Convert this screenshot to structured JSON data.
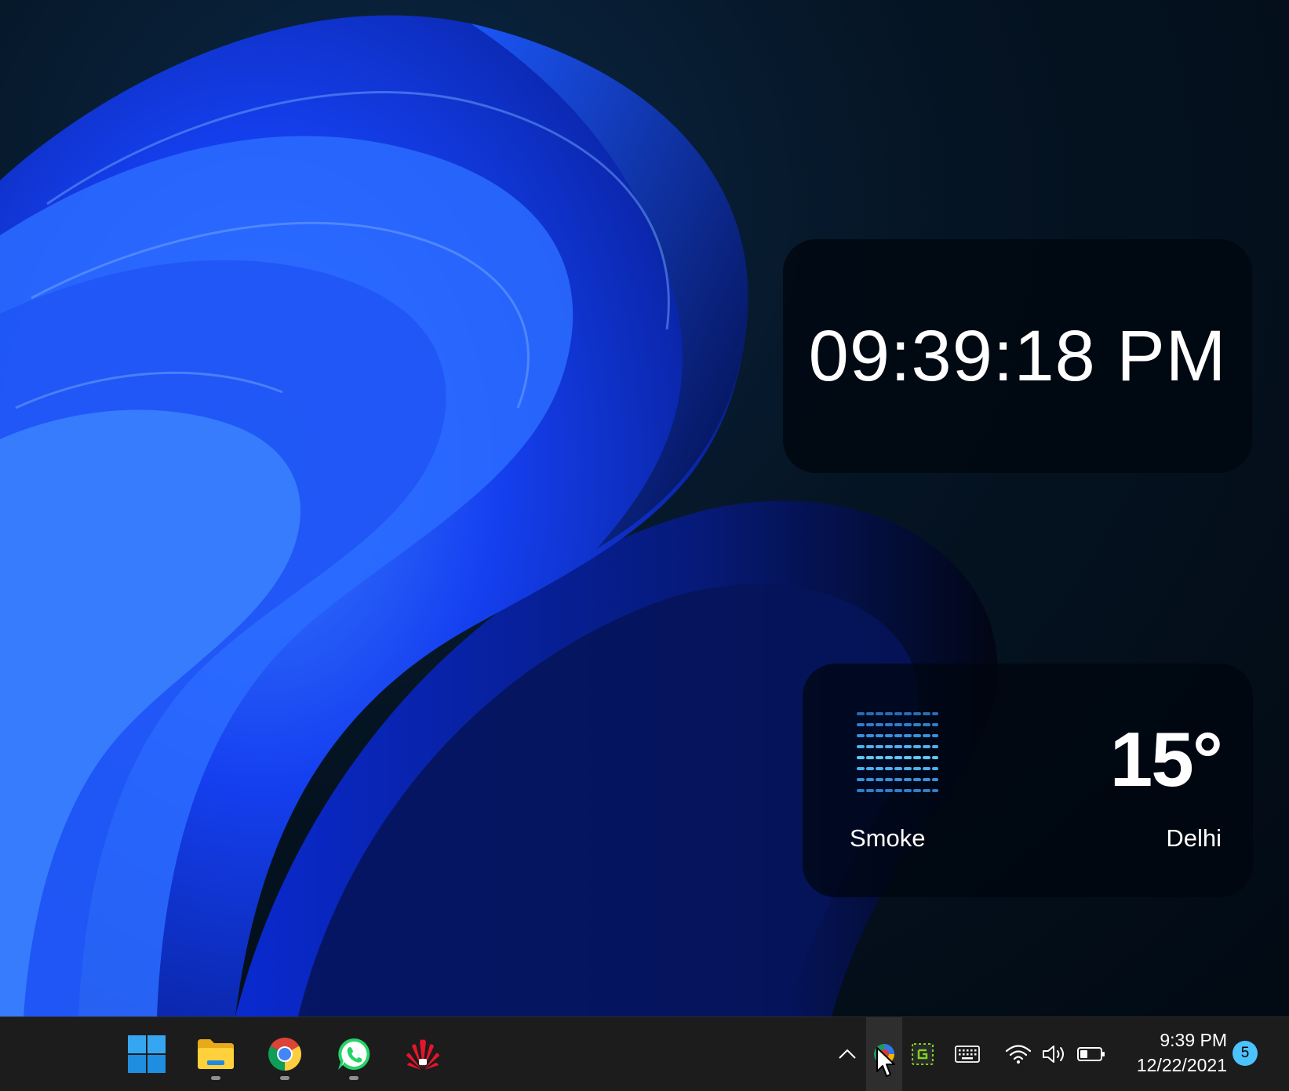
{
  "clock_widget": {
    "time": "09:39:18 PM"
  },
  "weather_widget": {
    "condition": "Smoke",
    "temperature": "15°",
    "city": "Delhi",
    "icon": "smoke-icon"
  },
  "taskbar": {
    "apps": [
      {
        "name": "Start",
        "icon": "windows-logo-icon"
      },
      {
        "name": "File Explorer",
        "icon": "folder-icon",
        "running": true
      },
      {
        "name": "Google Chrome",
        "icon": "chrome-icon",
        "running": true
      },
      {
        "name": "WhatsApp",
        "icon": "whatsapp-icon",
        "running": true
      },
      {
        "name": "Huawei",
        "icon": "huawei-icon",
        "running": false
      }
    ],
    "tray_icons": [
      "chevron-up-icon",
      "edge-canary-icon",
      "greenshot-icon",
      "keyboard-icon",
      "wifi-icon",
      "volume-icon",
      "battery-icon"
    ],
    "clock": {
      "time": "9:39 PM",
      "date": "12/22/2021"
    },
    "notification_count": "5"
  },
  "colors": {
    "taskbar": "#1c1c1c",
    "accent": "#4cc2ff",
    "wallpaper_blue": "#1a4cff"
  }
}
